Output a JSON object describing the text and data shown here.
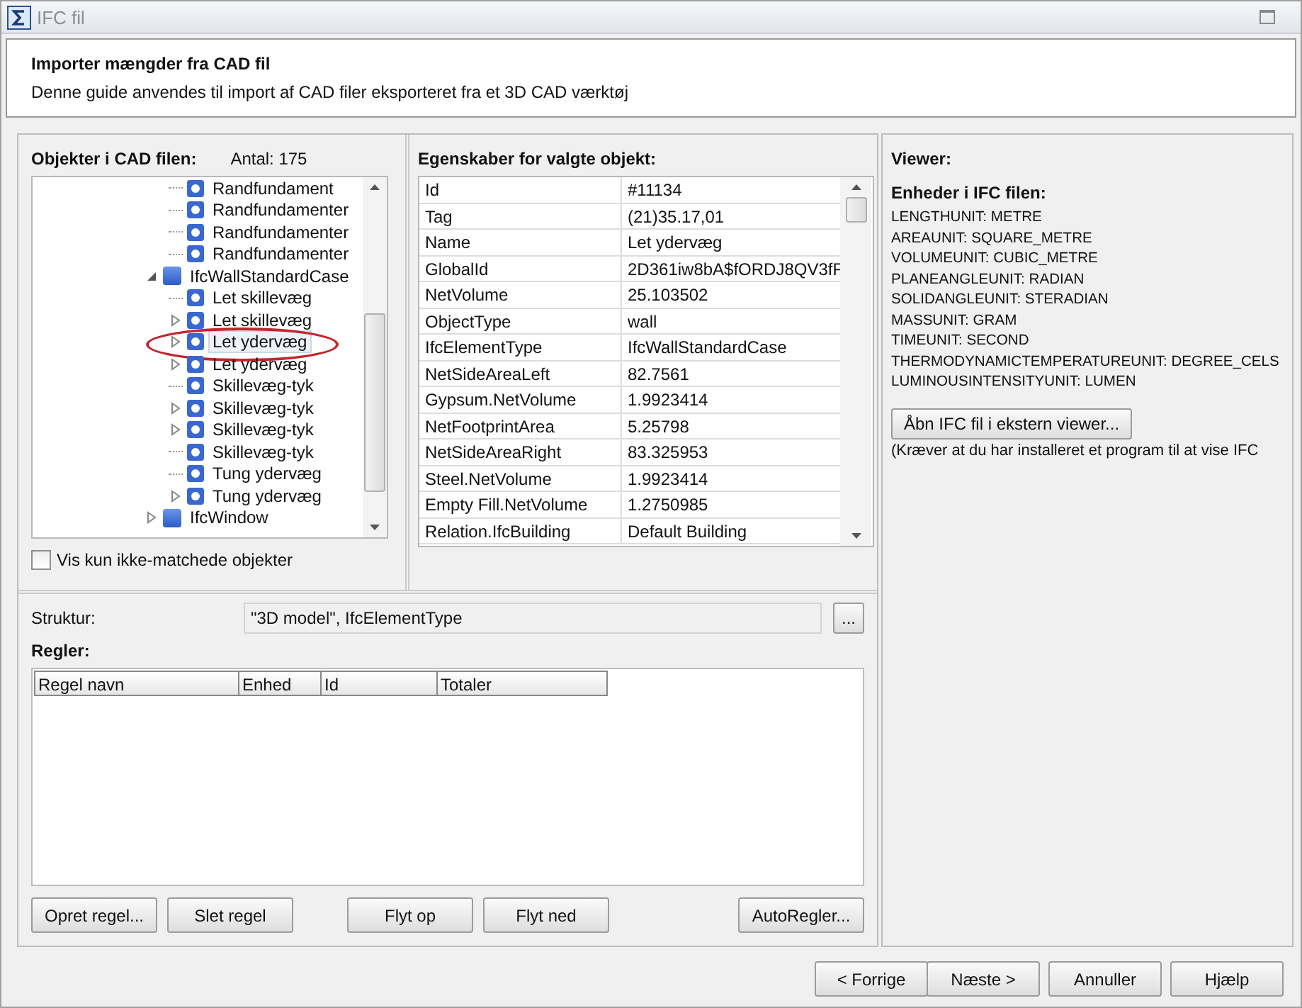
{
  "window": {
    "title": "IFC fil"
  },
  "header": {
    "title": "Importer mængder fra CAD fil",
    "description": "Denne guide anvendes til import af CAD filer eksporteret fra et 3D CAD værktøj"
  },
  "objects": {
    "title": "Objekter i CAD filen:",
    "count": "Antal: 175",
    "tree": {
      "partial_children": [
        {
          "label": "Randfundament",
          "kind": "instance",
          "expandable": false,
          "selected": false
        },
        {
          "label": "Randfundamenter",
          "kind": "instance",
          "expandable": false,
          "selected": false
        },
        {
          "label": "Randfundamenter",
          "kind": "instance",
          "expandable": false,
          "selected": false
        },
        {
          "label": "Randfundamenter",
          "kind": "instance",
          "expandable": false,
          "selected": false
        }
      ],
      "nodes": [
        {
          "label": "IfcWallStandardCase",
          "kind": "class",
          "expandable": true,
          "expanded": true,
          "selected": false,
          "children": [
            {
              "label": "Let skillevæg",
              "kind": "instance",
              "expandable": false,
              "selected": false
            },
            {
              "label": "Let skillevæg",
              "kind": "instance",
              "expandable": true,
              "expanded": false,
              "selected": false
            },
            {
              "label": "Let ydervæg",
              "kind": "instance",
              "expandable": true,
              "expanded": false,
              "selected": true
            },
            {
              "label": "Let ydervæg",
              "kind": "instance",
              "expandable": true,
              "expanded": false,
              "selected": false
            },
            {
              "label": "Skillevæg-tyk",
              "kind": "instance",
              "expandable": false,
              "selected": false
            },
            {
              "label": "Skillevæg-tyk",
              "kind": "instance",
              "expandable": true,
              "expanded": false,
              "selected": false
            },
            {
              "label": "Skillevæg-tyk",
              "kind": "instance",
              "expandable": true,
              "expanded": false,
              "selected": false
            },
            {
              "label": "Skillevæg-tyk",
              "kind": "instance",
              "expandable": false,
              "selected": false
            },
            {
              "label": "Tung ydervæg",
              "kind": "instance",
              "expandable": false,
              "selected": false
            },
            {
              "label": "Tung ydervæg",
              "kind": "instance",
              "expandable": true,
              "expanded": false,
              "selected": false
            }
          ]
        },
        {
          "label": "IfcWindow",
          "kind": "class",
          "expandable": true,
          "expanded": false,
          "selected": false
        }
      ]
    },
    "filter": {
      "label": "Vis kun ikke-matchede objekter",
      "checked": false
    }
  },
  "properties": {
    "title": "Egenskaber for valgte objekt:",
    "rows": [
      {
        "name": "Id",
        "value": "#11134"
      },
      {
        "name": "Tag",
        "value": "(21)35.17,01"
      },
      {
        "name": "Name",
        "value": "Let ydervæg"
      },
      {
        "name": "GlobalId",
        "value": "2D361iw8bA$fORDJ8QV3fF"
      },
      {
        "name": "NetVolume",
        "value": "25.103502"
      },
      {
        "name": "ObjectType",
        "value": "wall"
      },
      {
        "name": "IfcElementType",
        "value": "IfcWallStandardCase"
      },
      {
        "name": "NetSideAreaLeft",
        "value": "82.7561"
      },
      {
        "name": "Gypsum.NetVolume",
        "value": "1.9923414"
      },
      {
        "name": "NetFootprintArea",
        "value": "5.25798"
      },
      {
        "name": "NetSideAreaRight",
        "value": "83.325953"
      },
      {
        "name": "Steel.NetVolume",
        "value": "1.9923414"
      },
      {
        "name": "Empty Fill.NetVolume",
        "value": "1.2750985"
      },
      {
        "name": "Relation.IfcBuilding",
        "value": "Default Building"
      }
    ]
  },
  "structure": {
    "label": "Struktur:",
    "value": "\"3D model\", IfcElementType",
    "browse_button": "..."
  },
  "rules": {
    "title": "Regler:",
    "columns": [
      "Regel navn",
      "Enhed",
      "Id",
      "Totaler"
    ],
    "buttons": [
      {
        "label": "Opret regel...",
        "kind": "left"
      },
      {
        "label": "Slet regel",
        "kind": "left"
      },
      {
        "label": "Flyt op",
        "kind": "middle"
      },
      {
        "label": "Flyt ned",
        "kind": "middle"
      },
      {
        "label": "AutoRegler...",
        "kind": "right"
      }
    ]
  },
  "viewer": {
    "title": "Viewer:",
    "units_title": "Enheder i IFC filen:",
    "units": [
      "LENGTHUNIT: METRE",
      "AREAUNIT: SQUARE_METRE",
      "VOLUMEUNIT: CUBIC_METRE",
      "PLANEANGLEUNIT: RADIAN",
      "SOLIDANGLEUNIT: STERADIAN",
      "MASSUNIT: GRAM",
      "TIMEUNIT: SECOND",
      "THERMODYNAMICTEMPERATUREUNIT: DEGREE_CELS",
      "LUMINOUSINTENSITYUNIT: LUMEN"
    ],
    "open_button": "Åbn IFC fil i ekstern viewer...",
    "note": "(Kræver at du har installeret et program til at vise IFC"
  },
  "footer_buttons": [
    "< Forrige",
    "Næste >",
    "Annuller",
    "Hjælp"
  ]
}
